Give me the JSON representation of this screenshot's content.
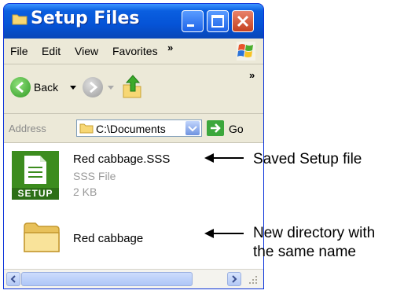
{
  "window": {
    "title": "Setup Files"
  },
  "menu": {
    "items": [
      "File",
      "Edit",
      "View",
      "Favorites"
    ],
    "overflow": "»"
  },
  "toolbar": {
    "back_label": "Back",
    "overflow": "»"
  },
  "address": {
    "label": "Address",
    "value": "C:\\Documents",
    "go_label": "Go"
  },
  "files": [
    {
      "name": "Red cabbage.SSS",
      "type": "SSS File",
      "size": "2 KB",
      "icon": "setup-file-icon",
      "icon_text": "SETUP"
    },
    {
      "name": "Red cabbage",
      "icon": "folder-icon"
    }
  ],
  "annotations": {
    "setup_file": "Saved Setup file",
    "directory_line1": "New directory with",
    "directory_line2": "the same name"
  },
  "colors": {
    "titlebar": "#0553d6",
    "close": "#c5411f",
    "chrome": "#ece9d8",
    "setup_green": "#3c8c1e"
  }
}
